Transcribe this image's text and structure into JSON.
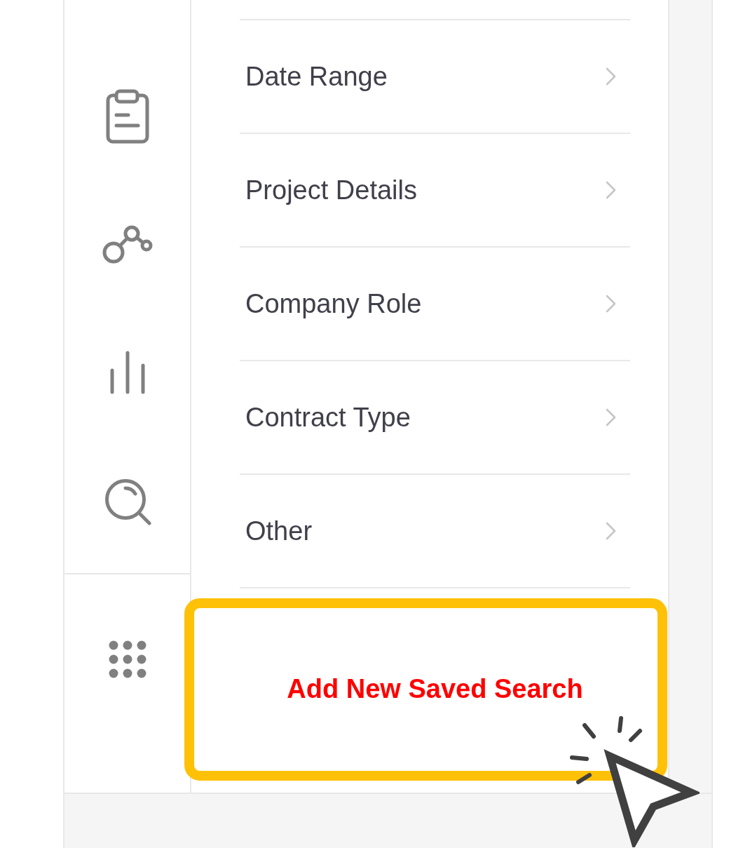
{
  "filter_list": {
    "items": [
      {
        "label": "Date Range"
      },
      {
        "label": "Project Details"
      },
      {
        "label": "Company Role"
      },
      {
        "label": "Contract Type"
      },
      {
        "label": "Other"
      }
    ]
  },
  "action_button": {
    "label": "Add New Saved Search",
    "highlighted": true
  }
}
